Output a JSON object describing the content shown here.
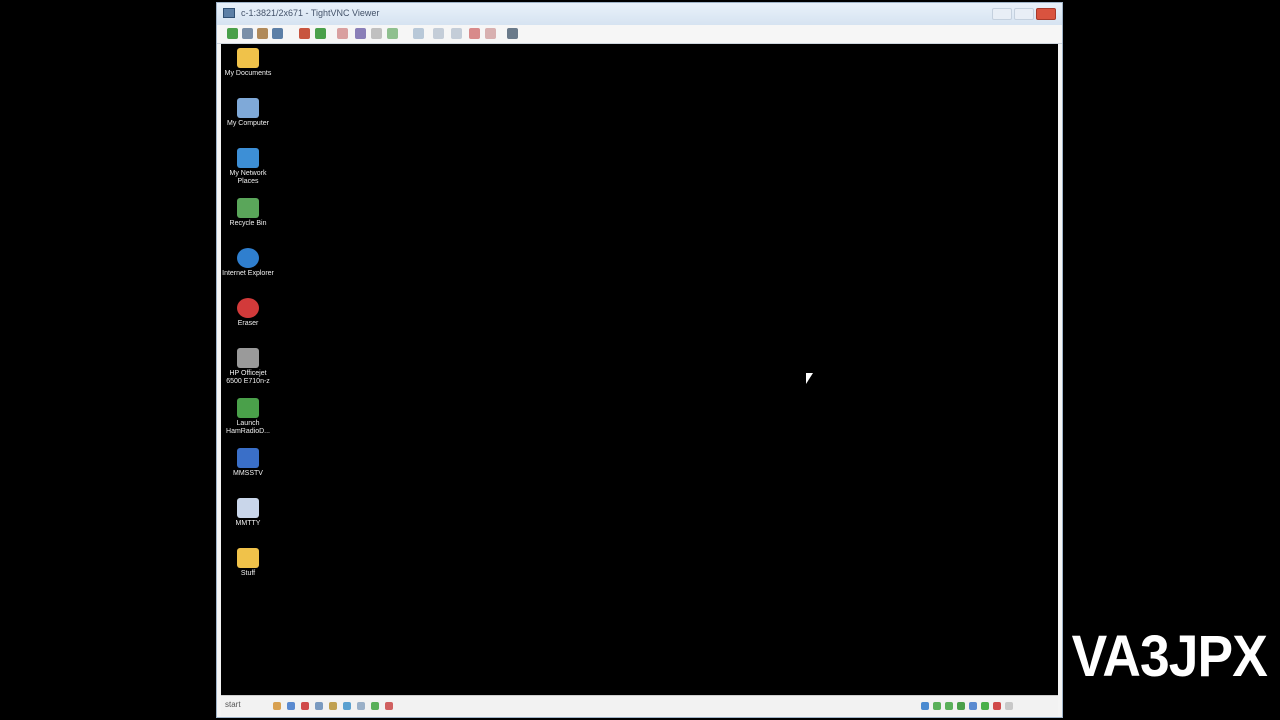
{
  "window": {
    "title": "c-1:3821/2x671 - TightVNC Viewer",
    "controls": {
      "minimize": "minimize",
      "maximize": "maximize",
      "close": "close"
    }
  },
  "toolbar": {
    "icons": [
      "new-connection-icon",
      "save-icon",
      "options-icon",
      "info-icon",
      "pause-icon",
      "refresh-icon",
      "ctrl-alt-del-icon",
      "ctrl-icon",
      "alt-icon",
      "windows-key-icon",
      "transfer-icon",
      "zoom-in-icon",
      "zoom-out-icon",
      "zoom-100-icon",
      "zoom-fit-icon",
      "fullscreen-icon"
    ]
  },
  "desktop": {
    "icons": [
      {
        "label": "My Documents",
        "icon": "folder-documents-icon",
        "color": "#f0c24a"
      },
      {
        "label": "My Computer",
        "icon": "computer-icon",
        "color": "#7fa9d8"
      },
      {
        "label": "My Network Places",
        "icon": "network-icon",
        "color": "#3d8fd6"
      },
      {
        "label": "Recycle Bin",
        "icon": "recycle-bin-icon",
        "color": "#5aa65a"
      },
      {
        "label": "Internet Explorer",
        "icon": "internet-explorer-icon",
        "color": "#2f7fcf"
      },
      {
        "label": "Eraser",
        "icon": "eraser-icon",
        "color": "#d23a3a"
      },
      {
        "label": "HP Officejet 6500 E710n-z",
        "icon": "printer-icon",
        "color": "#9a9a9a"
      },
      {
        "label": "Launch HamRadioD...",
        "icon": "ham-radio-icon",
        "color": "#4aa04a"
      },
      {
        "label": "MMSSTV",
        "icon": "mmsstv-icon",
        "color": "#3a6fc8"
      },
      {
        "label": "MMTTY",
        "icon": "mmtty-icon",
        "color": "#c9d6ea"
      },
      {
        "label": "Stuff",
        "icon": "folder-icon",
        "color": "#f0c24a"
      }
    ]
  },
  "taskbar": {
    "start_label": "start"
  },
  "watermark": {
    "text": "VA3JPX"
  }
}
